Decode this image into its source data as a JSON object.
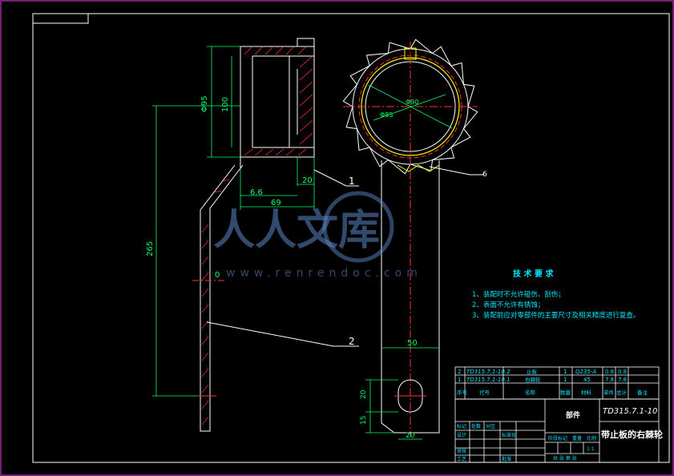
{
  "watermark": {
    "brand_text": "人人文库",
    "url": "www.renrendoc.com"
  },
  "dimensions": {
    "left_view": [
      "Φ95",
      "100",
      "6.6",
      "69",
      "20",
      "265",
      "0"
    ],
    "right_view": [
      "Φ90",
      "Φ85",
      "6",
      "50",
      "20",
      "15",
      "20"
    ]
  },
  "leaders": [
    "1",
    "2"
  ],
  "notes": {
    "title": "技 术 要 求",
    "items": [
      "1、装配时不允许碰伤、刮伤；",
      "2、表面不允许有锈蚀；",
      "3、装配前应对零部件的主要尺寸及相关精度进行复查。"
    ]
  },
  "parts_list": {
    "rows": [
      {
        "no": "2",
        "code": "TD315.7.1-10.2",
        "name": "止板",
        "qty": "1",
        "material": "Q235-A",
        "w1": "0.8",
        "w2": "0.8"
      },
      {
        "no": "1",
        "code": "TD315.7.1-10.1",
        "name": "右棘轮",
        "qty": "1",
        "material": "45",
        "w1": "7.8",
        "w2": "7.8"
      }
    ],
    "header": [
      "序号",
      "代号",
      "名称",
      "数量",
      "材料",
      "单件",
      "总计",
      "备注"
    ]
  },
  "title_block": {
    "part_type": "部件",
    "drawing_no": "TD315.7.1-10",
    "part_name": "带止板的右棘轮",
    "row_labels": [
      "标记",
      "处数",
      "分区",
      "设计",
      "审核",
      "工艺"
    ],
    "mid_labels": [
      "标准化",
      "批准"
    ],
    "stage_labels": [
      "阶段标记",
      "重量",
      "比例"
    ],
    "scale": "1:1",
    "sheet": "共 张 第 张"
  },
  "colors": {
    "background": "#000000",
    "outline": "#ffffff",
    "dimension": "#00ff66",
    "centerline": "#ff3333",
    "hatch": "#ff3333",
    "text": "#00e5ff",
    "highlight": "#ffff00",
    "border": "#9a2b9a"
  }
}
